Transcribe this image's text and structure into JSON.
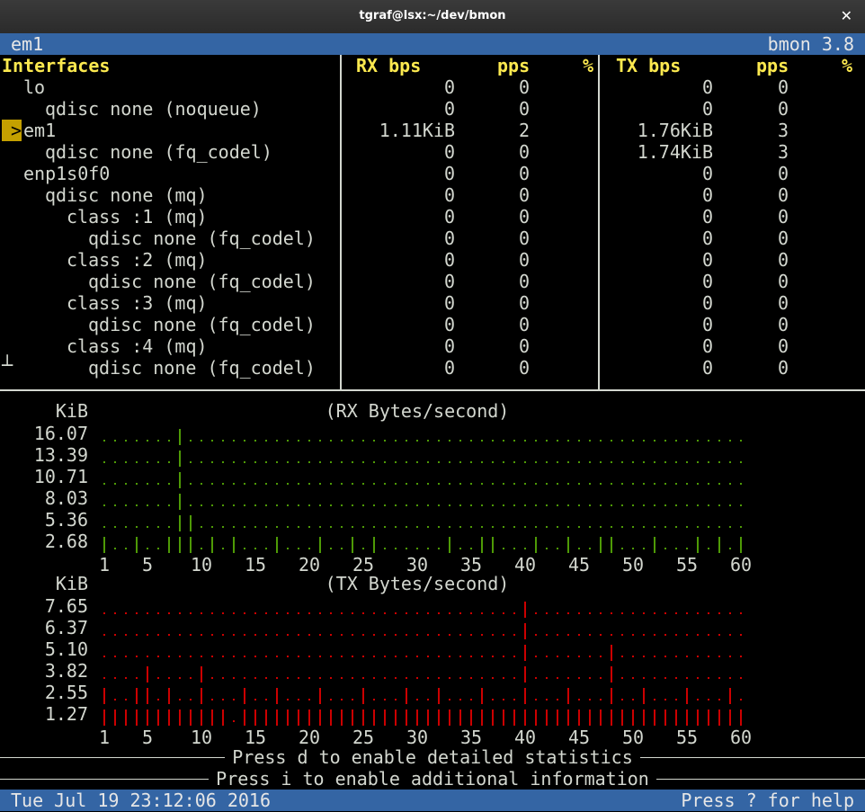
{
  "window": {
    "title": "tgraf@lsx:~/dev/bmon",
    "close_icon": "close-icon"
  },
  "topbar": {
    "left": "em1",
    "right": "bmon 3.8"
  },
  "headers": {
    "interfaces": "Interfaces",
    "rx_bps": "RX bps",
    "rx_pps": "pps",
    "rx_pct": "%",
    "tx_bps": "TX bps",
    "tx_pps": "pps",
    "tx_pct": "%"
  },
  "rows": [
    {
      "name": "lo",
      "indent": 1,
      "rx_bps": "0",
      "rx_pps": "0",
      "tx_bps": "0",
      "tx_pps": "0"
    },
    {
      "name": "qdisc none (noqueue)",
      "indent": 2,
      "rx_bps": "0",
      "rx_pps": "0",
      "tx_bps": "0",
      "tx_pps": "0"
    },
    {
      "name": "em1",
      "indent": 1,
      "selected": true,
      "marker": ">",
      "rx_bps": "1.11KiB",
      "rx_pps": "2",
      "tx_bps": "1.76KiB",
      "tx_pps": "3"
    },
    {
      "name": "qdisc none (fq_codel)",
      "indent": 2,
      "rx_bps": "0",
      "rx_pps": "0",
      "tx_bps": "1.74KiB",
      "tx_pps": "3"
    },
    {
      "name": "enp1s0f0",
      "indent": 1,
      "rx_bps": "0",
      "rx_pps": "0",
      "tx_bps": "0",
      "tx_pps": "0"
    },
    {
      "name": "qdisc none (mq)",
      "indent": 2,
      "rx_bps": "0",
      "rx_pps": "0",
      "tx_bps": "0",
      "tx_pps": "0"
    },
    {
      "name": "class :1 (mq)",
      "indent": 3,
      "rx_bps": "0",
      "rx_pps": "0",
      "tx_bps": "0",
      "tx_pps": "0"
    },
    {
      "name": "qdisc none (fq_codel)",
      "indent": 4,
      "rx_bps": "0",
      "rx_pps": "0",
      "tx_bps": "0",
      "tx_pps": "0"
    },
    {
      "name": "class :2 (mq)",
      "indent": 3,
      "rx_bps": "0",
      "rx_pps": "0",
      "tx_bps": "0",
      "tx_pps": "0"
    },
    {
      "name": "qdisc none (fq_codel)",
      "indent": 4,
      "rx_bps": "0",
      "rx_pps": "0",
      "tx_bps": "0",
      "tx_pps": "0"
    },
    {
      "name": "class :3 (mq)",
      "indent": 3,
      "rx_bps": "0",
      "rx_pps": "0",
      "tx_bps": "0",
      "tx_pps": "0"
    },
    {
      "name": "qdisc none (fq_codel)",
      "indent": 4,
      "rx_bps": "0",
      "rx_pps": "0",
      "tx_bps": "0",
      "tx_pps": "0"
    },
    {
      "name": "class :4 (mq)",
      "indent": 3,
      "rx_bps": "0",
      "rx_pps": "0",
      "tx_bps": "0",
      "tx_pps": "0"
    },
    {
      "name": "qdisc none (fq_codel)",
      "indent": 4,
      "rx_bps": "0",
      "rx_pps": "0",
      "tx_bps": "0",
      "tx_pps": "0"
    }
  ],
  "chart_data": [
    {
      "type": "bar",
      "title": "(RX Bytes/second)",
      "ylabel": "KiB",
      "yticks": [
        "16.07",
        "13.39",
        "10.71",
        "8.03",
        "5.36",
        "2.68"
      ],
      "ytick_values": [
        16.07,
        13.39,
        10.71,
        8.03,
        5.36,
        2.68
      ],
      "xticks": [
        "1",
        "5",
        "10",
        "15",
        "20",
        "25",
        "30",
        "35",
        "40",
        "45",
        "50",
        "55",
        "60"
      ],
      "color": "#4e9a06",
      "values": [
        2.7,
        1.3,
        1.3,
        2.7,
        1.3,
        1.3,
        2.7,
        16.1,
        8.0,
        1.3,
        2.7,
        1.3,
        2.7,
        1.3,
        1.3,
        1.3,
        2.7,
        1.3,
        1.3,
        1.3,
        2.7,
        1.3,
        1.3,
        2.7,
        1.3,
        2.7,
        1.3,
        1.3,
        0.8,
        1.3,
        1.3,
        1.3,
        2.7,
        1.3,
        0.8,
        2.7,
        2.7,
        1.3,
        1.3,
        1.3,
        2.7,
        1.3,
        1.3,
        2.7,
        0.8,
        1.3,
        2.7,
        2.7,
        1.3,
        1.3,
        1.3,
        2.7,
        0.8,
        1.3,
        1.3,
        2.7,
        1.3,
        2.7,
        1.3,
        2.7
      ]
    },
    {
      "type": "bar",
      "title": "(TX Bytes/second)",
      "ylabel": "KiB",
      "yticks": [
        "7.65",
        "6.37",
        "5.10",
        "3.82",
        "2.55",
        "1.27"
      ],
      "ytick_values": [
        7.65,
        6.37,
        5.1,
        3.82,
        2.55,
        1.27
      ],
      "xticks": [
        "1",
        "5",
        "10",
        "15",
        "20",
        "25",
        "30",
        "35",
        "40",
        "45",
        "50",
        "55",
        "60"
      ],
      "color": "#cc0000",
      "values": [
        2.6,
        1.3,
        1.3,
        2.6,
        3.9,
        1.3,
        2.6,
        1.3,
        1.3,
        3.9,
        1.3,
        1.3,
        0.6,
        2.6,
        1.3,
        1.3,
        2.6,
        1.3,
        1.3,
        1.3,
        2.6,
        1.3,
        1.3,
        1.3,
        2.6,
        1.3,
        1.3,
        1.3,
        2.6,
        1.3,
        1.3,
        2.6,
        1.3,
        1.3,
        1.3,
        2.6,
        1.3,
        1.3,
        1.3,
        7.7,
        1.3,
        1.3,
        1.3,
        2.6,
        1.3,
        1.3,
        1.3,
        5.1,
        1.3,
        1.3,
        2.6,
        1.3,
        1.3,
        1.3,
        2.6,
        1.3,
        1.3,
        1.3,
        2.6,
        1.3
      ]
    }
  ],
  "footer": {
    "hint1": "Press d to enable detailed statistics",
    "hint2": "Press i to enable additional information",
    "datetime": "Tue Jul 19 23:12:06 2016",
    "help": "Press ? for help"
  }
}
